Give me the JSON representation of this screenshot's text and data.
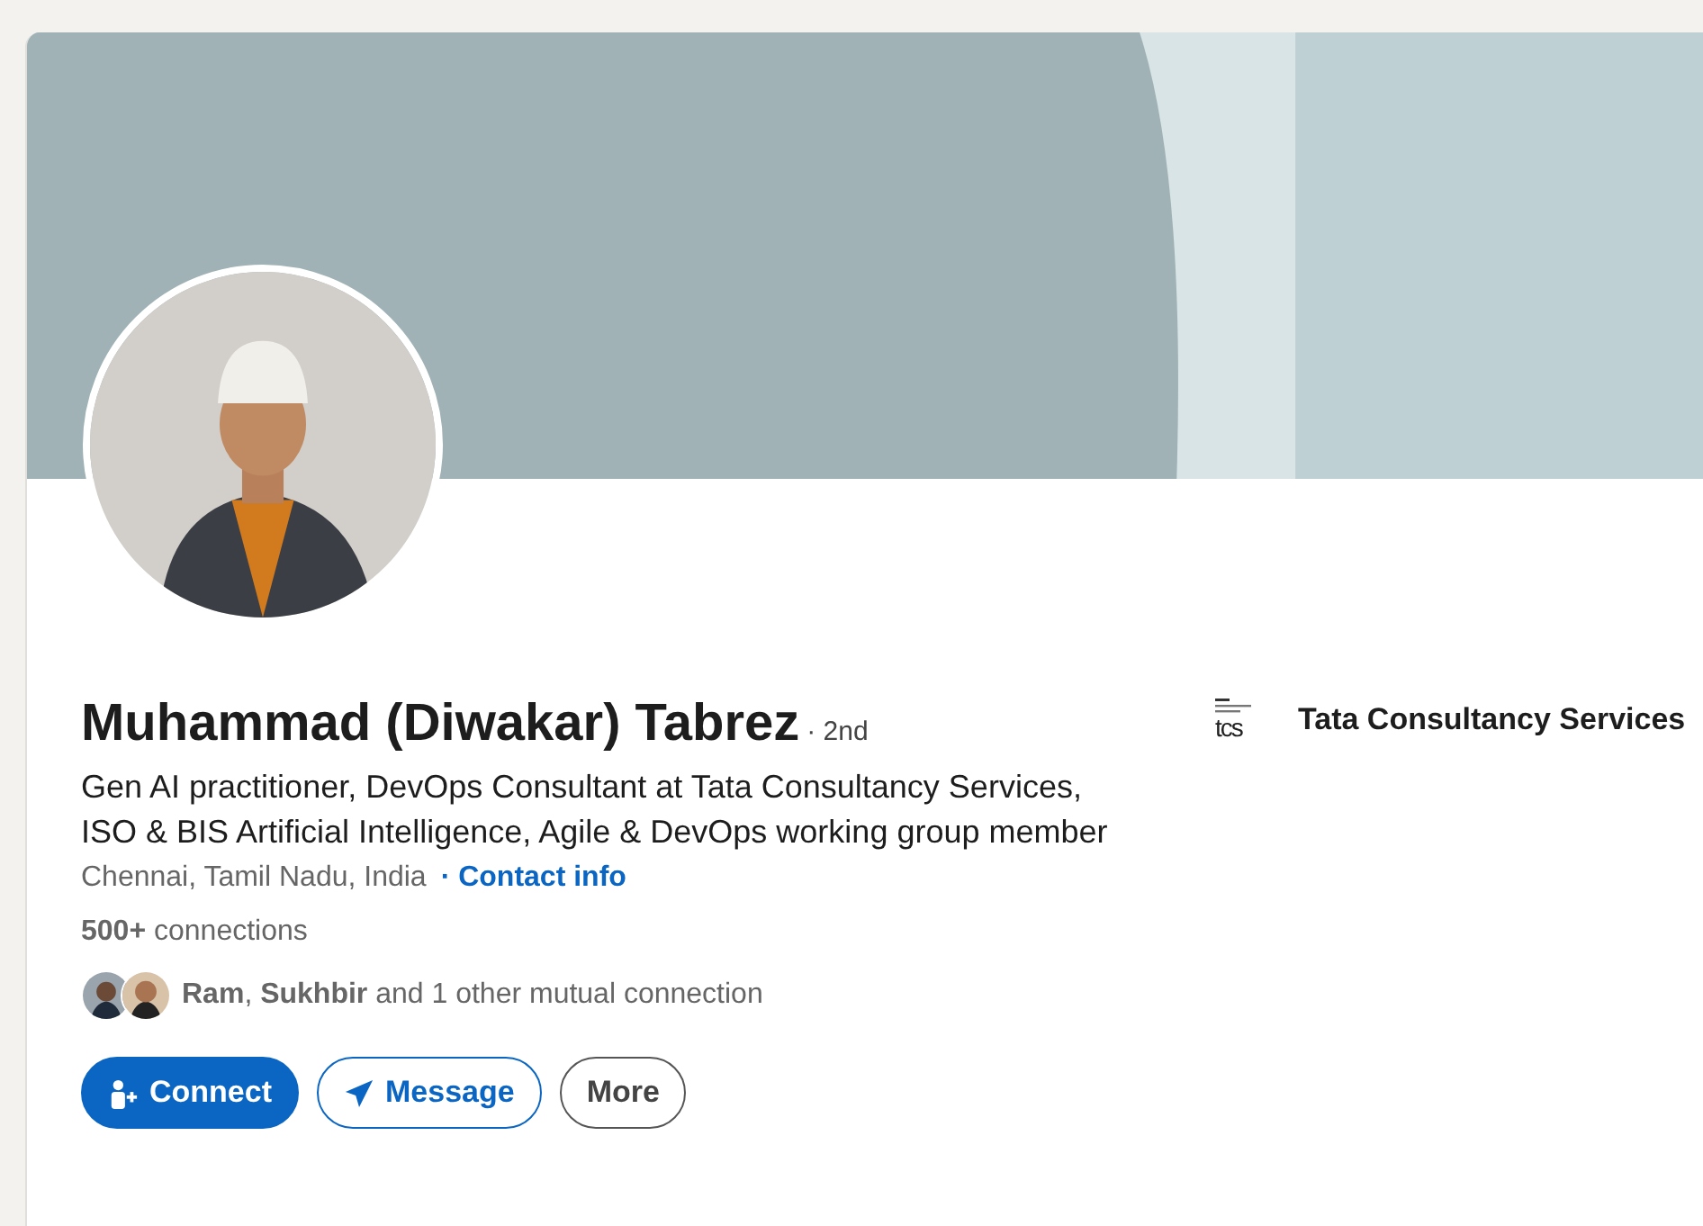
{
  "profile": {
    "name": "Muhammad (Diwakar) Tabrez",
    "degree": "· 2nd",
    "headline": "Gen AI practitioner, DevOps Consultant  at Tata Consultancy Services, ISO & BIS Artificial Intelligence, Agile & DevOps working group member",
    "location": "Chennai, Tamil Nadu, India",
    "contact_link": "· Contact info",
    "connections": "**500+** connections",
    "mutual": "**Ram**, **Sukhbir** and 1 other mutual connection"
  },
  "company": {
    "logo_mark": "tcs",
    "name": "Tata Consultancy Services"
  },
  "buttons": [
    {
      "kind": "primary",
      "label": "Connect"
    },
    {
      "kind": "secondary",
      "label": "Message"
    },
    {
      "kind": "outline",
      "label": "More"
    }
  ]
}
